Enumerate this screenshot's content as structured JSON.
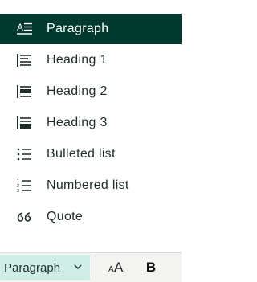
{
  "menu": {
    "items": [
      {
        "label": "Paragraph",
        "icon": "paragraph-icon",
        "selected": true
      },
      {
        "label": "Heading 1",
        "icon": "heading-1-icon",
        "selected": false
      },
      {
        "label": "Heading 2",
        "icon": "heading-2-icon",
        "selected": false
      },
      {
        "label": "Heading 3",
        "icon": "heading-3-icon",
        "selected": false
      },
      {
        "label": "Bulleted list",
        "icon": "bulleted-list-icon",
        "selected": false
      },
      {
        "label": "Numbered list",
        "icon": "numbered-list-icon",
        "selected": false
      },
      {
        "label": "Quote",
        "icon": "quote-icon",
        "selected": false
      }
    ]
  },
  "toolbar": {
    "style_value": "Paragraph",
    "font_size_small": "A",
    "font_size_large": "A",
    "bold_label": "B"
  },
  "colors": {
    "selected_bg": "#00392e",
    "select_bg": "#cfeee6",
    "text": "#1f2d2b"
  }
}
